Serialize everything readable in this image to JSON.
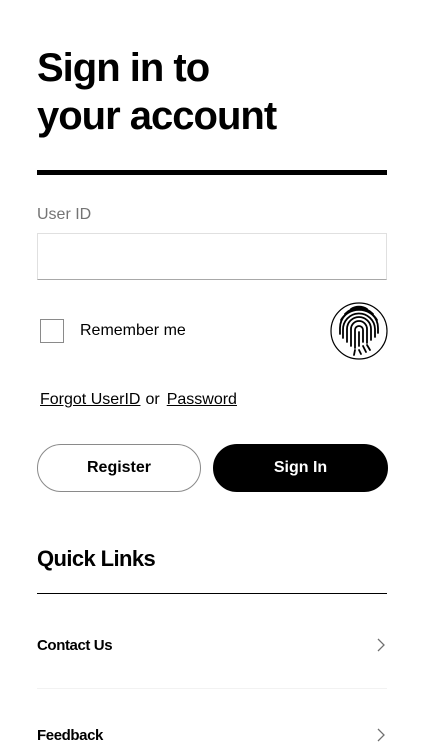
{
  "header": {
    "title_line1": "Sign in to",
    "title_line2": "your account"
  },
  "login": {
    "userid_label": "User ID",
    "userid_value": "",
    "remember_label": "Remember me",
    "remember_checked": false,
    "biometric_icon": "fingerprint-icon",
    "forgot_userid": "Forgot UserID",
    "forgot_or": "or",
    "forgot_password": "Password",
    "register_label": "Register",
    "signin_label": "Sign In"
  },
  "quick_links": {
    "title": "Quick Links",
    "items": [
      {
        "label": "Contact Us",
        "icon": "chevron-right-icon"
      },
      {
        "label": "Feedback",
        "icon": "chevron-right-icon"
      }
    ]
  },
  "colors": {
    "primary": "#000000",
    "background": "#ffffff",
    "label_gray": "#747474",
    "border_gray": "#8a8a8a"
  }
}
